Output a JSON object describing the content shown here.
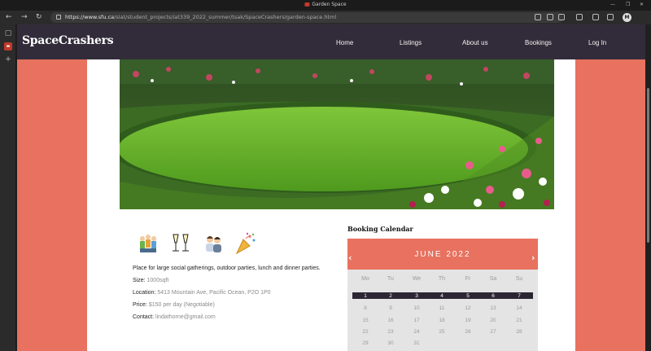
{
  "browser": {
    "tab_title": "Garden Space",
    "url_host": "https://www.sfu.ca",
    "url_path": "/siat/student_projects/iat339_2022_summer/tsak/SpaceCrashers/garden-space.html",
    "avatar_letter": "M"
  },
  "site": {
    "logo": "SpaceCrashers",
    "nav": [
      "Home",
      "Listings",
      "About us",
      "Bookings",
      "Log In"
    ]
  },
  "listing": {
    "description": "Place for large social gatherings, outdoor parties, lunch and dinner parties.",
    "size_label": "Size:",
    "size_value": "1000sqft",
    "location_label": "Location:",
    "location_value": "5413 Mountain Ave, Pacific Ocean, P2O 1P0",
    "price_label": "Price:",
    "price_value": "$150 per day (Negotiable)",
    "contact_label": "Contact:",
    "contact_value": "lindathorne@gmail.com",
    "icons": [
      "group-of-people-icon",
      "champagne-toast-icon",
      "couple-icon",
      "party-popper-icon"
    ]
  },
  "calendar": {
    "heading": "Booking Calendar",
    "month": "JUNE 2022",
    "prev": "‹",
    "next": "›",
    "weekdays": [
      "Mo",
      "Tu",
      "We",
      "Th",
      "Fr",
      "Sa",
      "Su"
    ],
    "highlighted_week": [
      "1",
      "2",
      "3",
      "4",
      "5",
      "6",
      "7"
    ],
    "weeks": [
      [
        "8",
        "9",
        "10",
        "11",
        "12",
        "13",
        "14"
      ],
      [
        "15",
        "16",
        "17",
        "18",
        "19",
        "20",
        "21"
      ],
      [
        "22",
        "23",
        "24",
        "25",
        "26",
        "27",
        "28"
      ],
      [
        "29",
        "30",
        "31",
        "",
        "",
        "",
        ""
      ]
    ]
  },
  "colors": {
    "accent": "#e8715f",
    "nav_bg": "#322c3a"
  }
}
